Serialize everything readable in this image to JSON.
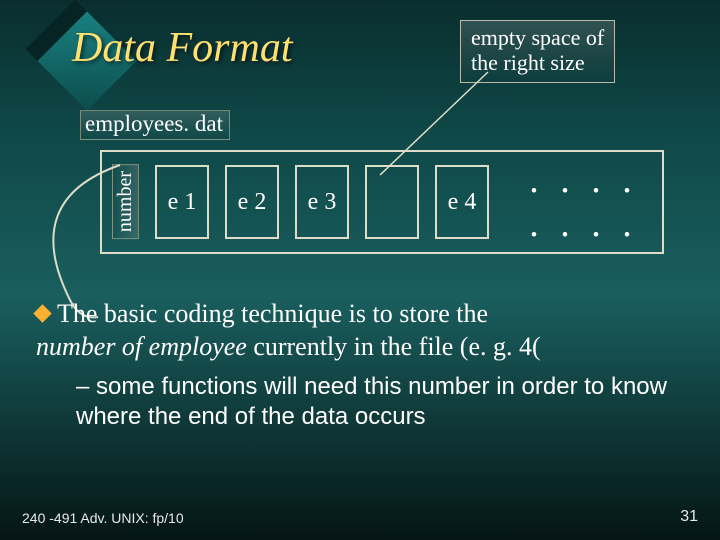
{
  "title": "Data Format",
  "callout": {
    "line1": "empty space of",
    "line2": "the right size"
  },
  "filename": "employees. dat",
  "num_label": "number",
  "cells": [
    "e 1",
    "e 2",
    "e 3",
    "",
    "e 4"
  ],
  "dots": ". . . . . . . .",
  "bullet": {
    "lead": "The ",
    "mid1": "basic coding technique is to store the ",
    "ital": "number of employee",
    "mid2": " currently in the file (e. g. 4("
  },
  "sub_bullet": "– some functions will need this number in order to know where the end of the data occurs",
  "footer_left": "240 -491 Adv. UNIX: fp/10",
  "footer_right": "31"
}
